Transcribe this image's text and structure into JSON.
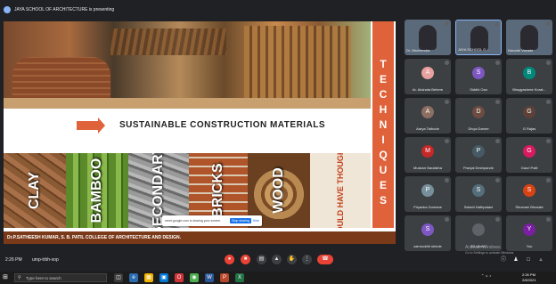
{
  "presenter": {
    "text": "JAYA SCHOOL OF ARCHITECTURE is presenting"
  },
  "slide": {
    "side_word": "TECHNIQUES",
    "title": "SUSTAINABLE CONSTRUCTION MATERIALS",
    "tiles": [
      "CLAY",
      "BAMBOO",
      "SECONDARY",
      "BRICKS",
      "WOOD",
      "WHO WOULD HAVE THOUGHT THIS?"
    ],
    "share_popup": {
      "text": "meet.google.com is sharing your screen.",
      "stop": "Stop sharing",
      "hide": "Hide"
    },
    "footer": "Dr.P.SATHEESH KUMAR, S. B. PATIL COLLEGE OF ARCHITECTURE AND DESIGN."
  },
  "participants": [
    {
      "name": "Dr. Manvendra",
      "initial": "",
      "color": "#5a6a7a",
      "video": true
    },
    {
      "name": "JAYA SCHOOL O...",
      "initial": "",
      "color": "#5a6a7a",
      "video": true
    },
    {
      "name": "Nanade Vazade",
      "initial": "",
      "color": "#5a6a7a",
      "video": true
    },
    {
      "name": "Ar. Akshata Behere",
      "initial": "A",
      "color": "#e8a0a0",
      "video": false
    },
    {
      "name": "Siddhi Oza",
      "initial": "S",
      "color": "#7e57c2",
      "video": false
    },
    {
      "name": "Bhagyashree Korat...",
      "initial": "B",
      "color": "#00897b",
      "video": false
    },
    {
      "name": "Aarya Tathode",
      "initial": "A",
      "color": "#8d6e63",
      "video": false
    },
    {
      "name": "Divya Damre",
      "initial": "D",
      "color": "#6d4c41",
      "video": false
    },
    {
      "name": "G Rajas",
      "initial": "G",
      "color": "#5d4037",
      "video": false
    },
    {
      "name": "Muskan Naulakha",
      "initial": "M",
      "color": "#c62828",
      "video": false
    },
    {
      "name": "Pranjal Deshpande",
      "initial": "P",
      "color": "#455a64",
      "video": false
    },
    {
      "name": "Gauri Patil",
      "initial": "G",
      "color": "#d81b60",
      "video": false
    },
    {
      "name": "Priyanka Dumane",
      "initial": "P",
      "color": "#78909c",
      "video": false
    },
    {
      "name": "Sakshi Nathpatani",
      "initial": "S",
      "color": "#546e7a",
      "video": false
    },
    {
      "name": "Shravani Bhosale",
      "initial": "S",
      "color": "#d84315",
      "video": false
    },
    {
      "name": "samruddhi shinde",
      "initial": "S",
      "color": "#7e57c2",
      "video": false
    },
    {
      "name": "63 others",
      "initial": "",
      "color": "#5f6368",
      "video": false
    },
    {
      "name": "You",
      "initial": "Y",
      "color": "#7b1fa2",
      "video": false
    }
  ],
  "meeting": {
    "time": "2:26 PM",
    "code": "ump-trbh-xop"
  },
  "controls": [
    "mic",
    "camera",
    "captions",
    "present",
    "raise-hand",
    "more",
    "end-call"
  ],
  "activate": {
    "line1": "Activate Windows",
    "line2": "Go to Settings to activate Windows."
  },
  "taskbar": {
    "search_placeholder": "Type here to search",
    "clock_time": "2:26 PM",
    "clock_date": "2/8/2021"
  }
}
